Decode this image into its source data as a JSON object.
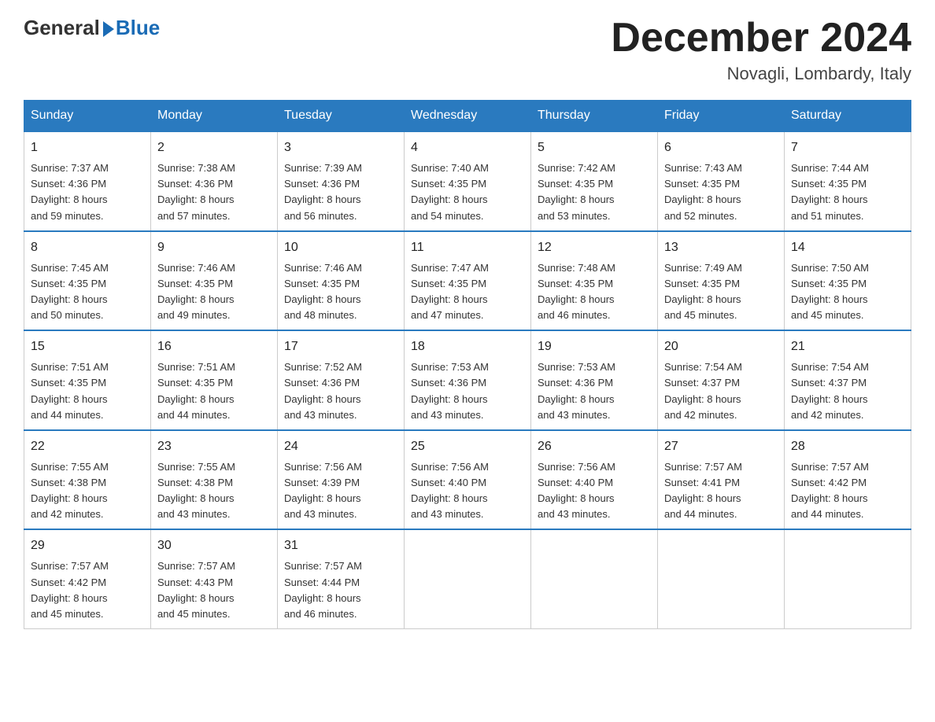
{
  "header": {
    "logo_general": "General",
    "logo_blue": "Blue",
    "month_title": "December 2024",
    "location": "Novagli, Lombardy, Italy"
  },
  "days_of_week": [
    "Sunday",
    "Monday",
    "Tuesday",
    "Wednesday",
    "Thursday",
    "Friday",
    "Saturday"
  ],
  "weeks": [
    [
      {
        "day": "1",
        "sunrise": "7:37 AM",
        "sunset": "4:36 PM",
        "daylight": "8 hours and 59 minutes."
      },
      {
        "day": "2",
        "sunrise": "7:38 AM",
        "sunset": "4:36 PM",
        "daylight": "8 hours and 57 minutes."
      },
      {
        "day": "3",
        "sunrise": "7:39 AM",
        "sunset": "4:36 PM",
        "daylight": "8 hours and 56 minutes."
      },
      {
        "day": "4",
        "sunrise": "7:40 AM",
        "sunset": "4:35 PM",
        "daylight": "8 hours and 54 minutes."
      },
      {
        "day": "5",
        "sunrise": "7:42 AM",
        "sunset": "4:35 PM",
        "daylight": "8 hours and 53 minutes."
      },
      {
        "day": "6",
        "sunrise": "7:43 AM",
        "sunset": "4:35 PM",
        "daylight": "8 hours and 52 minutes."
      },
      {
        "day": "7",
        "sunrise": "7:44 AM",
        "sunset": "4:35 PM",
        "daylight": "8 hours and 51 minutes."
      }
    ],
    [
      {
        "day": "8",
        "sunrise": "7:45 AM",
        "sunset": "4:35 PM",
        "daylight": "8 hours and 50 minutes."
      },
      {
        "day": "9",
        "sunrise": "7:46 AM",
        "sunset": "4:35 PM",
        "daylight": "8 hours and 49 minutes."
      },
      {
        "day": "10",
        "sunrise": "7:46 AM",
        "sunset": "4:35 PM",
        "daylight": "8 hours and 48 minutes."
      },
      {
        "day": "11",
        "sunrise": "7:47 AM",
        "sunset": "4:35 PM",
        "daylight": "8 hours and 47 minutes."
      },
      {
        "day": "12",
        "sunrise": "7:48 AM",
        "sunset": "4:35 PM",
        "daylight": "8 hours and 46 minutes."
      },
      {
        "day": "13",
        "sunrise": "7:49 AM",
        "sunset": "4:35 PM",
        "daylight": "8 hours and 45 minutes."
      },
      {
        "day": "14",
        "sunrise": "7:50 AM",
        "sunset": "4:35 PM",
        "daylight": "8 hours and 45 minutes."
      }
    ],
    [
      {
        "day": "15",
        "sunrise": "7:51 AM",
        "sunset": "4:35 PM",
        "daylight": "8 hours and 44 minutes."
      },
      {
        "day": "16",
        "sunrise": "7:51 AM",
        "sunset": "4:35 PM",
        "daylight": "8 hours and 44 minutes."
      },
      {
        "day": "17",
        "sunrise": "7:52 AM",
        "sunset": "4:36 PM",
        "daylight": "8 hours and 43 minutes."
      },
      {
        "day": "18",
        "sunrise": "7:53 AM",
        "sunset": "4:36 PM",
        "daylight": "8 hours and 43 minutes."
      },
      {
        "day": "19",
        "sunrise": "7:53 AM",
        "sunset": "4:36 PM",
        "daylight": "8 hours and 43 minutes."
      },
      {
        "day": "20",
        "sunrise": "7:54 AM",
        "sunset": "4:37 PM",
        "daylight": "8 hours and 42 minutes."
      },
      {
        "day": "21",
        "sunrise": "7:54 AM",
        "sunset": "4:37 PM",
        "daylight": "8 hours and 42 minutes."
      }
    ],
    [
      {
        "day": "22",
        "sunrise": "7:55 AM",
        "sunset": "4:38 PM",
        "daylight": "8 hours and 42 minutes."
      },
      {
        "day": "23",
        "sunrise": "7:55 AM",
        "sunset": "4:38 PM",
        "daylight": "8 hours and 43 minutes."
      },
      {
        "day": "24",
        "sunrise": "7:56 AM",
        "sunset": "4:39 PM",
        "daylight": "8 hours and 43 minutes."
      },
      {
        "day": "25",
        "sunrise": "7:56 AM",
        "sunset": "4:40 PM",
        "daylight": "8 hours and 43 minutes."
      },
      {
        "day": "26",
        "sunrise": "7:56 AM",
        "sunset": "4:40 PM",
        "daylight": "8 hours and 43 minutes."
      },
      {
        "day": "27",
        "sunrise": "7:57 AM",
        "sunset": "4:41 PM",
        "daylight": "8 hours and 44 minutes."
      },
      {
        "day": "28",
        "sunrise": "7:57 AM",
        "sunset": "4:42 PM",
        "daylight": "8 hours and 44 minutes."
      }
    ],
    [
      {
        "day": "29",
        "sunrise": "7:57 AM",
        "sunset": "4:42 PM",
        "daylight": "8 hours and 45 minutes."
      },
      {
        "day": "30",
        "sunrise": "7:57 AM",
        "sunset": "4:43 PM",
        "daylight": "8 hours and 45 minutes."
      },
      {
        "day": "31",
        "sunrise": "7:57 AM",
        "sunset": "4:44 PM",
        "daylight": "8 hours and 46 minutes."
      },
      null,
      null,
      null,
      null
    ]
  ],
  "labels": {
    "sunrise_prefix": "Sunrise: ",
    "sunset_prefix": "Sunset: ",
    "daylight_prefix": "Daylight: "
  }
}
